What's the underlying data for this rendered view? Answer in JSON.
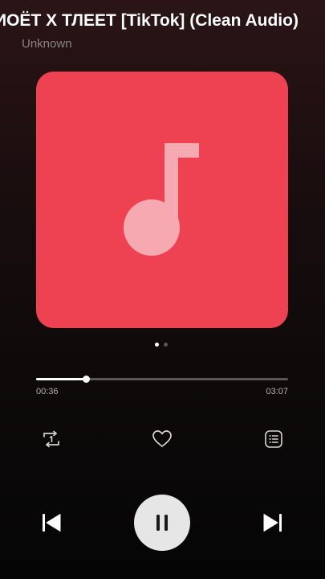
{
  "track": {
    "title": "ИОЁТ Х ТЛЕЕТ [TikTok] (Clean Audio)",
    "artist": "Unknown"
  },
  "album_art": {
    "background_color": "#ee4253",
    "icon": "music-note-icon"
  },
  "pager": {
    "page_count": 2,
    "current_page": 1
  },
  "progress": {
    "elapsed": "00:36",
    "total": "03:07",
    "fraction": 0.2
  },
  "actions": {
    "repeat_icon": "repeat-one-icon",
    "favorite_icon": "heart-icon",
    "playlist_icon": "playlist-icon"
  },
  "controls": {
    "previous_icon": "skip-previous-icon",
    "play_pause_icon": "pause-icon",
    "next_icon": "skip-next-icon"
  },
  "colors": {
    "accent": "#ee4253",
    "text_primary": "#ffffff",
    "text_secondary": "#8a8484",
    "play_button": "#e6e6e6"
  }
}
